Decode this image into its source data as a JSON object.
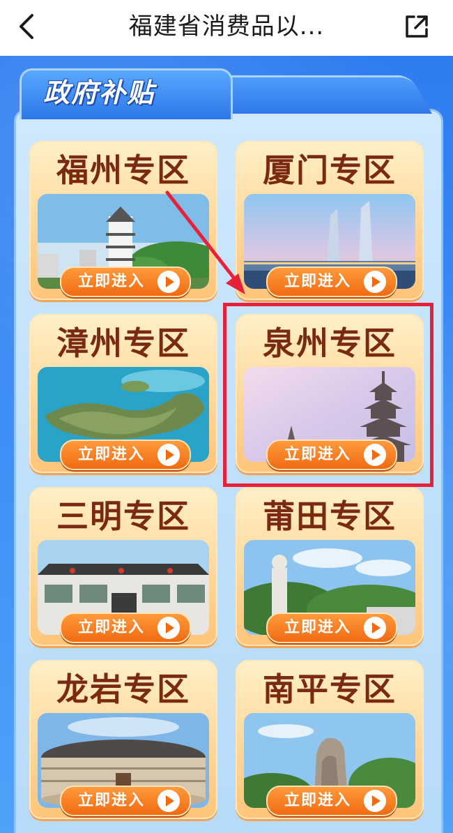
{
  "header": {
    "title": "福建省消费品以...",
    "back_icon": "chevron-left-icon",
    "share_icon": "external-link-icon"
  },
  "section": {
    "title": "政府补贴"
  },
  "colors": {
    "page_blue": "#3b8bf5",
    "card_orange": "#ffd79a",
    "button_orange": "#f06a12",
    "title_brown": "#7a2a10",
    "highlight_red": "#e8213a"
  },
  "cards": [
    {
      "title": "福州专区",
      "button": "立即进入"
    },
    {
      "title": "厦门专区",
      "button": "立即进入"
    },
    {
      "title": "漳州专区",
      "button": "立即进入"
    },
    {
      "title": "泉州专区",
      "button": "立即进入"
    },
    {
      "title": "三明专区",
      "button": "立即进入"
    },
    {
      "title": "莆田专区",
      "button": "立即进入"
    },
    {
      "title": "龙岩专区",
      "button": "立即进入"
    },
    {
      "title": "南平专区",
      "button": "立即进入"
    }
  ]
}
